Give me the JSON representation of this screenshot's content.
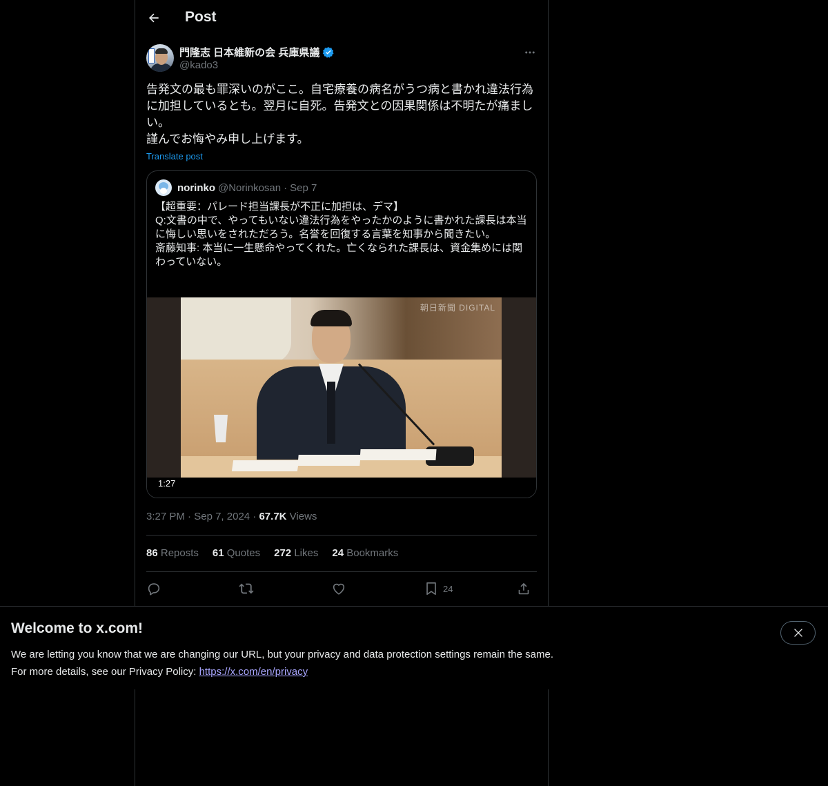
{
  "header": {
    "title": "Post"
  },
  "post": {
    "author_name": "門隆志 日本維新の会 兵庫県議",
    "author_handle": "@kado3",
    "text": "告発文の最も罪深いのがここ。自宅療養の病名がうつ病と書かれ違法行為\nに加担しているとも。翌月に自死。告発文との因果関係は不明たが痛まし\nい。\n謹んでお悔やみ申し上げます。",
    "translate_label": "Translate post",
    "time": "3:27 PM",
    "date": "Sep 7, 2024",
    "views_count": "67.7K",
    "views_label": "Views",
    "separator": "·"
  },
  "quote": {
    "name": "norinko",
    "handle": "@Norinkosan",
    "separator": "·",
    "date": "Sep 7",
    "text": "【超重要：パレード担当課長が不正に加担は、デマ】\nQ:文書の中で、やってもいない違法行為をやったかのように書かれた課長は本当\nに悔しい思いをされただろう。名誉を回復する言葉を知事から聞きたい。\n斎藤知事: 本当に一生懸命やってくれた。亡くなられた課長は、資金集めには関\nわっていない。",
    "video_duration": "1:27",
    "watermark": "朝日新聞 DIGITAL"
  },
  "stats": {
    "reposts_count": "86",
    "reposts_label": "Reposts",
    "quotes_count": "61",
    "quotes_label": "Quotes",
    "likes_count": "272",
    "likes_label": "Likes",
    "bookmarks_count": "24",
    "bookmarks_label": "Bookmarks"
  },
  "actions": {
    "bookmark_count": "24"
  },
  "banner": {
    "title": "Welcome to x.com!",
    "line1": "We are letting you know that we are changing our URL, but your privacy and data protection settings remain the same.",
    "line2_prefix": "For more details, see our Privacy Policy: ",
    "link": "https://x.com/en/privacy"
  },
  "colors": {
    "accent": "#1d9bf0",
    "muted": "#71767b",
    "link": "#a9a6ff",
    "border": "#2f3336"
  },
  "icons": [
    "back-arrow-icon",
    "verified-badge-icon",
    "more-icon",
    "reply-icon",
    "repost-icon",
    "like-icon",
    "bookmark-icon",
    "share-icon",
    "close-icon"
  ]
}
